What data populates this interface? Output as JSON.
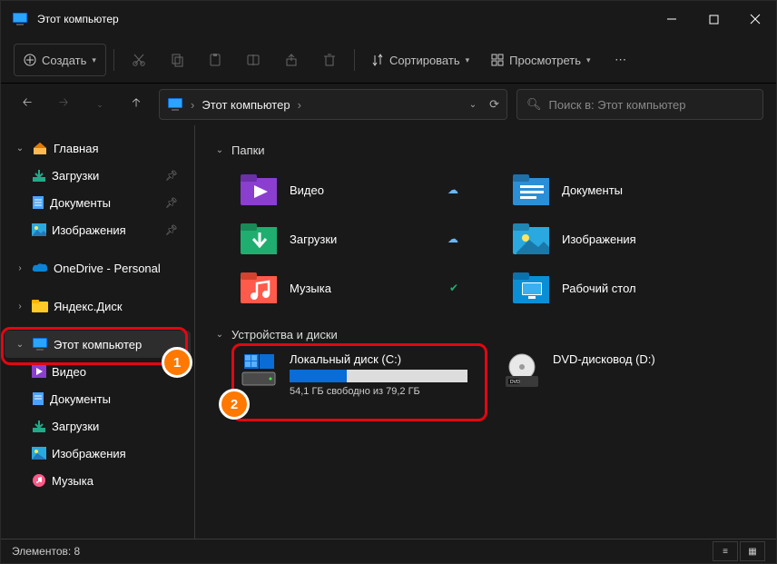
{
  "titlebar": {
    "title": "Этот компьютер"
  },
  "toolbar": {
    "create": "Создать",
    "sort": "Сортировать",
    "view": "Просмотреть"
  },
  "nav": {
    "breadcrumb": "Этот компьютер"
  },
  "search": {
    "placeholder": "Поиск в: Этот компьютер"
  },
  "sidebar": {
    "home": "Главная",
    "downloads": "Загрузки",
    "documents": "Документы",
    "pictures": "Изображения",
    "onedrive": "OneDrive - Personal",
    "yandex": "Яндекс.Диск",
    "thispc": "Этот компьютер",
    "video": "Видео",
    "documents2": "Документы",
    "downloads2": "Загрузки",
    "pictures2": "Изображения",
    "music": "Музыка"
  },
  "main": {
    "folders_header": "Папки",
    "devices_header": "Устройства и диски",
    "folders": {
      "video": "Видео",
      "documents": "Документы",
      "downloads": "Загрузки",
      "pictures": "Изображения",
      "music": "Музыка",
      "desktop": "Рабочий стол"
    },
    "drive_c": {
      "name": "Локальный диск (C:)",
      "sub": "54,1 ГБ свободно из 79,2 ГБ",
      "fill_pct": 32
    },
    "drive_dvd": {
      "name": "DVD-дисковод (D:)"
    }
  },
  "status": {
    "items": "Элементов: 8"
  },
  "markers": {
    "one": "1",
    "two": "2"
  }
}
